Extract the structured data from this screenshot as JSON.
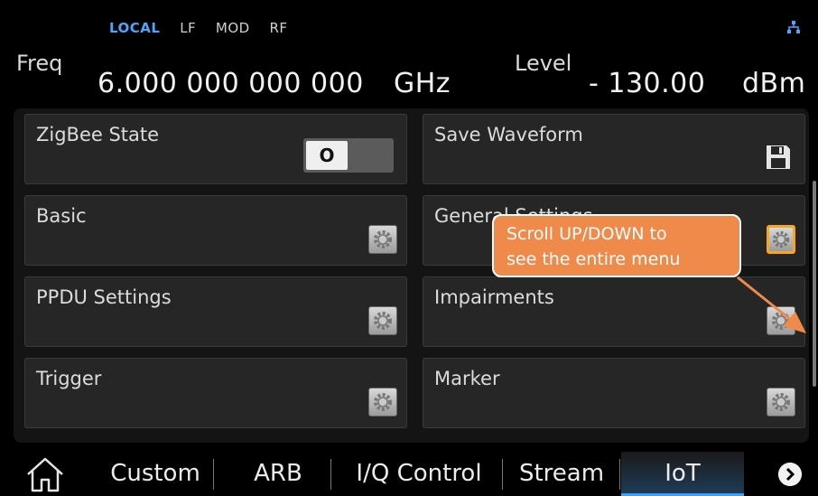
{
  "status": {
    "modes": [
      "LOCAL",
      "LF",
      "MOD",
      "RF"
    ],
    "active_mode": "LOCAL",
    "network_icon": "network-icon"
  },
  "freq": {
    "label": "Freq",
    "value": "6.000 000 000 000",
    "unit": "GHz"
  },
  "level": {
    "label": "Level",
    "value": "- 130.00",
    "unit": "dBm"
  },
  "menu": {
    "zigbee_state": {
      "title": "ZigBee State",
      "toggle_value": "O",
      "state": "off"
    },
    "save_waveform": {
      "title": "Save Waveform",
      "icon": "floppy-disk-icon"
    },
    "basic": {
      "title": "Basic",
      "icon": "gear-icon"
    },
    "general_settings": {
      "title": "General Settings",
      "icon": "gear-icon"
    },
    "ppdu_settings": {
      "title": "PPDU Settings",
      "icon": "gear-icon"
    },
    "impairments": {
      "title": "Impairments",
      "icon": "gear-icon"
    },
    "trigger": {
      "title": "Trigger",
      "icon": "gear-icon"
    },
    "marker": {
      "title": "Marker",
      "icon": "gear-icon"
    }
  },
  "callout": {
    "line1": "Scroll UP/DOWN to",
    "line2": "see the entire menu"
  },
  "tabs": {
    "home_icon": "home-icon",
    "items": [
      "Custom",
      "ARB",
      "I/Q Control",
      "Stream",
      "IoT"
    ],
    "selected": "IoT",
    "next_icon": "chevron-right-icon"
  },
  "colors": {
    "accent": "#3aa0ff",
    "callout": "#f08a4b",
    "highlight": "#f5a623"
  }
}
